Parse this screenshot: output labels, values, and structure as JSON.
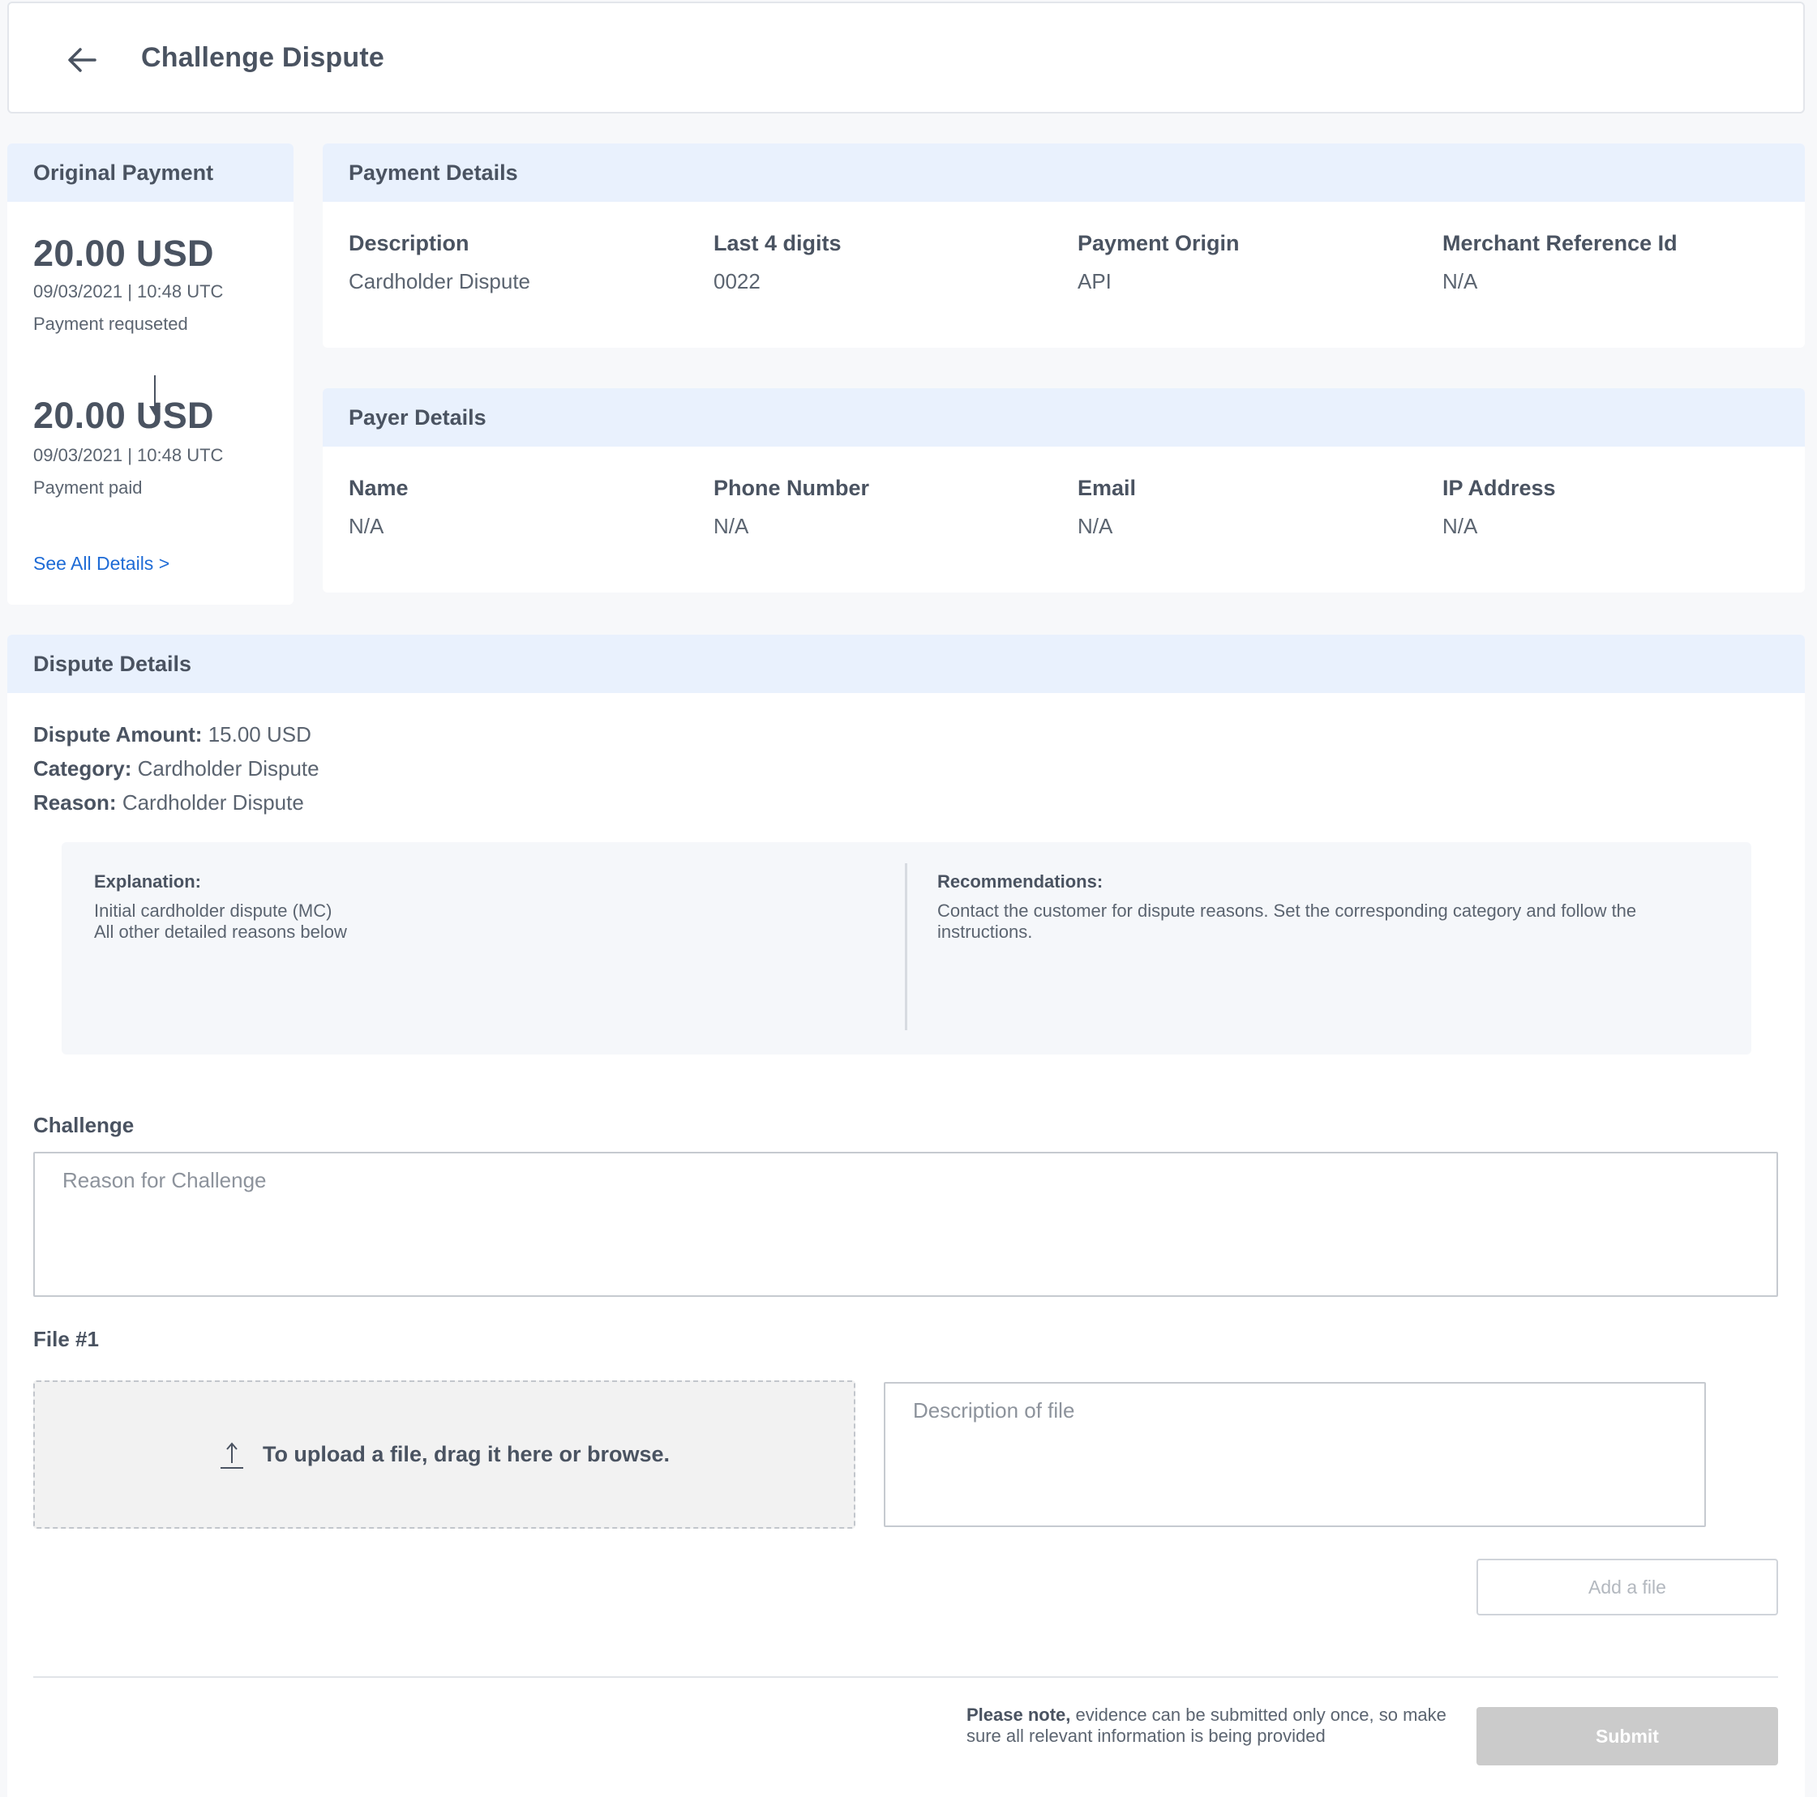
{
  "header": {
    "title": "Challenge Dispute",
    "back_icon": "arrow-left-icon"
  },
  "original_payment": {
    "title": "Original Payment",
    "requested": {
      "amount": "20.00 USD",
      "datetime": "09/03/2021 | 10:48 UTC",
      "status": "Payment requseted"
    },
    "paid": {
      "amount": "20.00 USD",
      "datetime": "09/03/2021 | 10:48 UTC",
      "status": "Payment paid"
    },
    "see_all_label": "See All Details >"
  },
  "payment_details": {
    "title": "Payment Details",
    "fields": [
      {
        "label": "Description",
        "value": "Cardholder Dispute"
      },
      {
        "label": "Last 4 digits",
        "value": "0022"
      },
      {
        "label": "Payment Origin",
        "value": "API"
      },
      {
        "label": "Merchant Reference Id",
        "value": "N/A"
      }
    ]
  },
  "payer_details": {
    "title": "Payer Details",
    "fields": [
      {
        "label": "Name",
        "value": "N/A"
      },
      {
        "label": "Phone Number",
        "value": "N/A"
      },
      {
        "label": "Email",
        "value": "N/A"
      },
      {
        "label": "IP Address",
        "value": "N/A"
      }
    ]
  },
  "dispute": {
    "title": "Dispute Details",
    "amount_label": "Dispute Amount:",
    "amount_value": "15.00 USD",
    "category_label": "Category:",
    "category_value": "Cardholder Dispute",
    "reason_label": "Reason:",
    "reason_value": "Cardholder Dispute",
    "explanation_title": "Explanation:",
    "explanation_line1": "Initial cardholder dispute (MC)",
    "explanation_line2": "All other detailed reasons below",
    "recommendations_title": "Recommendations:",
    "recommendations_text": "Contact the customer for dispute reasons. Set the corresponding category and follow the instructions."
  },
  "challenge": {
    "label": "Challenge",
    "reason_placeholder": "Reason for Challenge",
    "reason_value": "",
    "file_label": "File #1",
    "upload_label": "To upload a file, drag it here or browse.",
    "upload_icon": "upload-icon",
    "file_description_placeholder": "Description of file",
    "add_file_label": "Add a file",
    "note_bold": "Please note,",
    "note_text": " evidence can be submitted only once, so make sure all relevant information is being provided",
    "submit_label": "Submit"
  },
  "colors": {
    "accent_link": "#1e6bd6",
    "section_header_bg": "#e9f1fd",
    "disabled_button": "#cbcbcb"
  }
}
